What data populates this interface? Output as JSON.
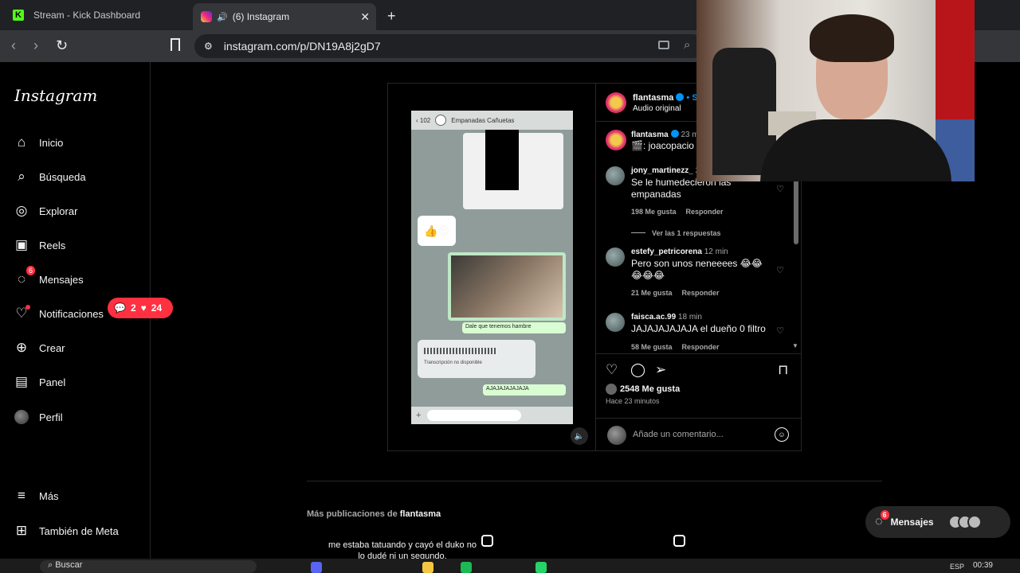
{
  "browser": {
    "tabs": [
      {
        "title": "Stream - Kick Dashboard",
        "active": false
      },
      {
        "title": "(6) Instagram",
        "active": true
      }
    ],
    "url": "instagram.com/p/DN19A8j2gD7"
  },
  "sidebar": {
    "logo": "Instagram",
    "items": [
      {
        "label": "Inicio",
        "icon": "home-icon"
      },
      {
        "label": "Búsqueda",
        "icon": "search-icon"
      },
      {
        "label": "Explorar",
        "icon": "compass-icon"
      },
      {
        "label": "Reels",
        "icon": "reels-icon"
      },
      {
        "label": "Mensajes",
        "icon": "messenger-icon",
        "badge": "6"
      },
      {
        "label": "Notificaciones",
        "icon": "heart-icon"
      },
      {
        "label": "Crear",
        "icon": "plus-square-icon"
      },
      {
        "label": "Panel",
        "icon": "chart-icon"
      },
      {
        "label": "Perfil",
        "icon": "avatar"
      },
      {
        "label": "Más",
        "icon": "menu-icon"
      },
      {
        "label": "También de Meta",
        "icon": "meta-grid-icon"
      }
    ],
    "notif_pill": {
      "comments": "2",
      "likes": "24"
    }
  },
  "post": {
    "media": {
      "chat_name": "Empanadas Cañuetas",
      "back_count": "102",
      "text_bubble": "Dale que tenemos hambre",
      "audio_note": "Transcripción no disponible",
      "laugh_bubble": "AJAJAJAJAJAJA"
    },
    "header": {
      "username": "flantasma",
      "follow_label": "• Se",
      "audio": "Audio original"
    },
    "caption": {
      "username": "flantasma",
      "time": "23 m",
      "text": "🎬: joacopacio"
    },
    "comments": [
      {
        "user": "jony_martinezz_",
        "time": "2",
        "text": "Se le humedecieron las empanadas",
        "likes": "198 Me gusta",
        "reply": "Responder"
      },
      {
        "user": "estefy_petricorena",
        "time": "12 min",
        "text": "Pero son unos neneeees 😂😂😂😂😂",
        "likes": "21 Me gusta",
        "reply": "Responder"
      },
      {
        "user": "faisca.ac.99",
        "time": "18 min",
        "text": "JAJAJAJAJAJA el dueño 0 filtro",
        "likes": "58 Me gusta",
        "reply": "Responder"
      }
    ],
    "view_replies": "Ver las 1 respuestas",
    "likes_count": "2548 Me gusta",
    "posted_ago": "Hace 23 minutos",
    "comment_placeholder": "Añade un comentario..."
  },
  "more_posts": {
    "prefix": "Más publicaciones de ",
    "username": "flantasma",
    "thumb_caption": "me estaba tatuando y cayó el duko no lo dudé ni un segundo."
  },
  "messages_float": {
    "label": "Mensajes",
    "badge": "6"
  },
  "taskbar": {
    "search_placeholder": "Buscar",
    "lang": "ESP",
    "time": "00:39"
  }
}
